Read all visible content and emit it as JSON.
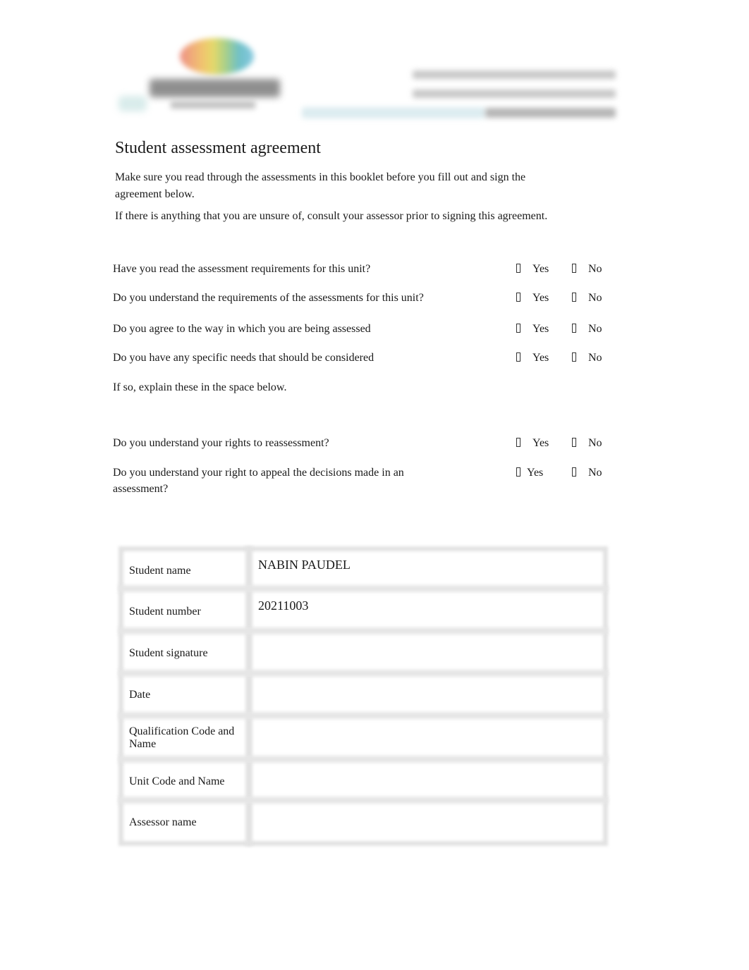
{
  "document": {
    "title": "Student assessment agreement",
    "intro_paragraphs": [
      "Make sure you read through the assessments in this booklet before you fill out and sign the agreement below.",
      "If there is anything that you are unsure of, consult your assessor prior to signing this agreement."
    ]
  },
  "questions": [
    {
      "text": "Have you read the assessment requirements for this unit?",
      "yes": "Yes",
      "no": "No"
    },
    {
      "text": "Do you understand the requirements of the assessments for this unit?",
      "yes": "Yes",
      "no": "No"
    },
    {
      "text": "Do you agree to the way in which you are being assessed",
      "yes": "Yes",
      "no": "No"
    },
    {
      "text": "Do you have any specific needs that should be considered",
      "yes": "Yes",
      "no": "No"
    },
    {
      "text": "If so, explain these in the space below."
    },
    {
      "text": "Do you understand your rights to reassessment?",
      "yes": "Yes",
      "no": "No"
    },
    {
      "text": "Do you understand your right to appeal the decisions made in an assessment?",
      "yes": "Yes",
      "no": "No"
    }
  ],
  "checkbox_glyph": "missing-glyph-box",
  "details_table": {
    "rows": [
      {
        "label": "Student name",
        "value": "NABIN PAUDEL"
      },
      {
        "label": "Student number",
        "value": "20211003"
      },
      {
        "label": "Student signature",
        "value": ""
      },
      {
        "label": "Date",
        "value": ""
      },
      {
        "label": "Qualification Code and Name",
        "value": ""
      },
      {
        "label": "Unit Code and Name",
        "value": ""
      },
      {
        "label": "Assessor name",
        "value": ""
      }
    ]
  }
}
